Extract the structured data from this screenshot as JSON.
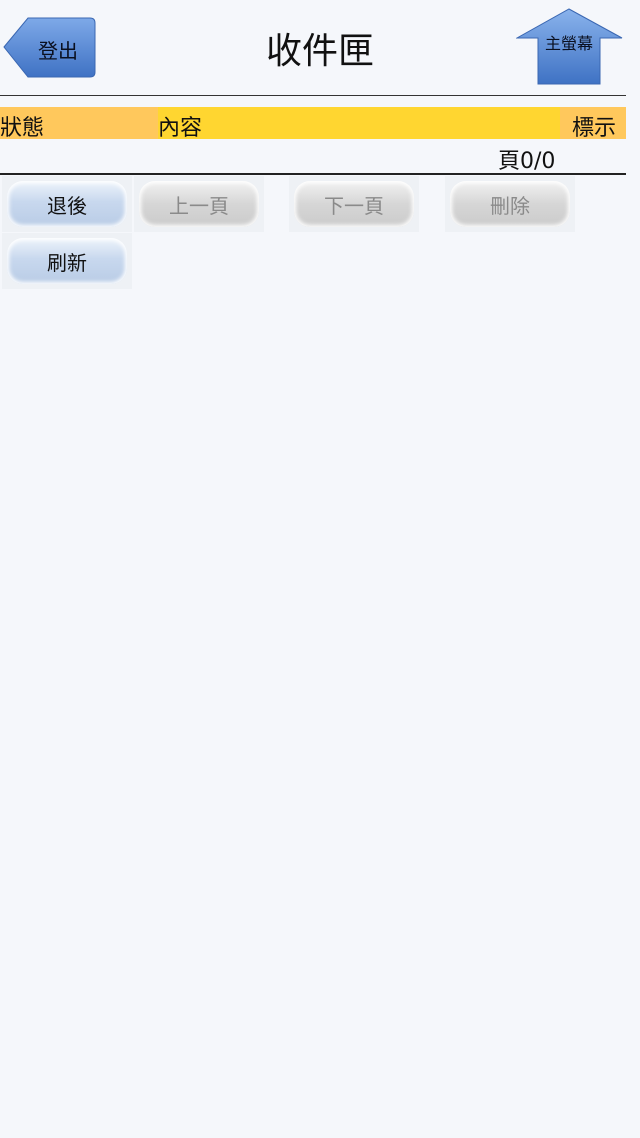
{
  "header": {
    "title": "收件匣",
    "logout_label": "登出",
    "home_label": "主螢幕"
  },
  "table": {
    "columns": [
      "狀態",
      "內容",
      "標示"
    ],
    "page_indicator": "頁0/0"
  },
  "buttons": {
    "back": "退後",
    "prev_page": "上一頁",
    "next_page": "下一頁",
    "delete": "刪除",
    "refresh": "刷新"
  },
  "colors": {
    "accent_blue": "#4a7fd0",
    "header_orange": "#ffc85c",
    "header_yellow": "#ffd630"
  }
}
